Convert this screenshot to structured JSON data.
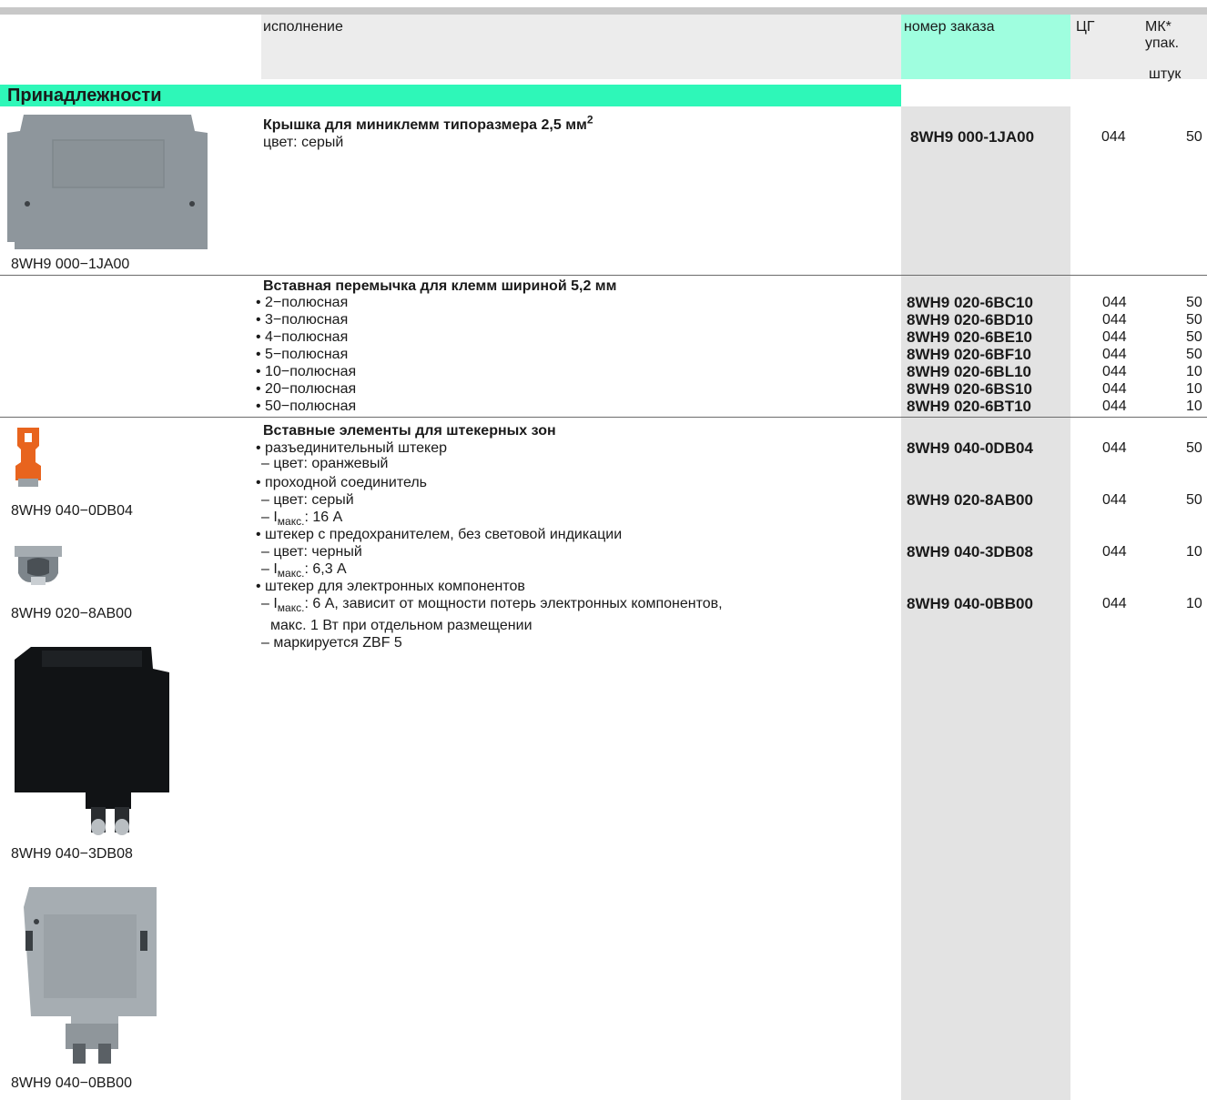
{
  "header": {
    "description": "исполнение",
    "order_number": "номер заказа",
    "cg": "ЦГ",
    "mk_line1": "МК*",
    "mk_line2": "упак.",
    "unit": "штук"
  },
  "colors": {
    "section": "#2ef7b8",
    "order_header": "#9ffedf",
    "order_column": "#e3e3e3",
    "header_bg": "#ececec"
  },
  "section": {
    "title": "Принадлежности"
  },
  "blocks": {
    "cover": {
      "title": "Крышка для миниклемм типоразмера 2,5 мм",
      "title_sup": "2",
      "color_line": "цвет: серый",
      "order": "8WH9 000-1JA00",
      "cg": "044",
      "mk": "50",
      "image_caption": "8WH9 000−1JA00"
    },
    "jumper": {
      "title": "Вставная перемычка для клемм шириной 5,2 мм",
      "rows": [
        {
          "label": "• 2−полюсная",
          "order": "8WH9 020-6BC10",
          "cg": "044",
          "mk": "50"
        },
        {
          "label": "• 3−полюсная",
          "order": "8WH9 020-6BD10",
          "cg": "044",
          "mk": "50"
        },
        {
          "label": "• 4−полюсная",
          "order": "8WH9 020-6BE10",
          "cg": "044",
          "mk": "50"
        },
        {
          "label": "• 5−полюсная",
          "order": "8WH9 020-6BF10",
          "cg": "044",
          "mk": "50"
        },
        {
          "label": "• 10−полюсная",
          "order": "8WH9 020-6BL10",
          "cg": "044",
          "mk": "10"
        },
        {
          "label": "• 20−полюсная",
          "order": "8WH9 020-6BS10",
          "cg": "044",
          "mk": "10"
        },
        {
          "label": "• 50−полюсная",
          "order": "8WH9 020-6BT10",
          "cg": "044",
          "mk": "10"
        }
      ]
    },
    "inserts": {
      "title": "Вставные элементы для штекерных зон",
      "l1": "• разъединительный штекер",
      "l2": "– цвет: оранжевый",
      "l3": "• проходной соединитель",
      "l4": "– цвет: серый",
      "l5_pre": "– I",
      "l5_sub": "макс.",
      "l5_post": ": 16 А",
      "l6": "• штекер с предохранителем, без световой индикации",
      "l7": "– цвет: черный",
      "l8_pre": "– I",
      "l8_sub": "макс.",
      "l8_post": ": 6,3 А",
      "l9": "• штекер для электронных компонентов",
      "l10_pre": "– I",
      "l10_sub": "макс.",
      "l10_post": ": 6 А, зависит от мощности потерь электронных компонентов,",
      "l11": "макс. 1 Вт при отдельном размещении",
      "l12": "– маркируется ZBF 5",
      "orders": [
        {
          "order": "8WH9 040-0DB04",
          "cg": "044",
          "mk": "50"
        },
        {
          "order": "8WH9 020-8AB00",
          "cg": "044",
          "mk": "50"
        },
        {
          "order": "8WH9 040-3DB08",
          "cg": "044",
          "mk": "10"
        },
        {
          "order": "8WH9 040-0BB00",
          "cg": "044",
          "mk": "10"
        }
      ],
      "captions": [
        "8WH9 040−0DB04",
        "8WH9 020−8AB00",
        "8WH9 040−3DB08",
        "8WH9 040−0BB00"
      ]
    }
  }
}
